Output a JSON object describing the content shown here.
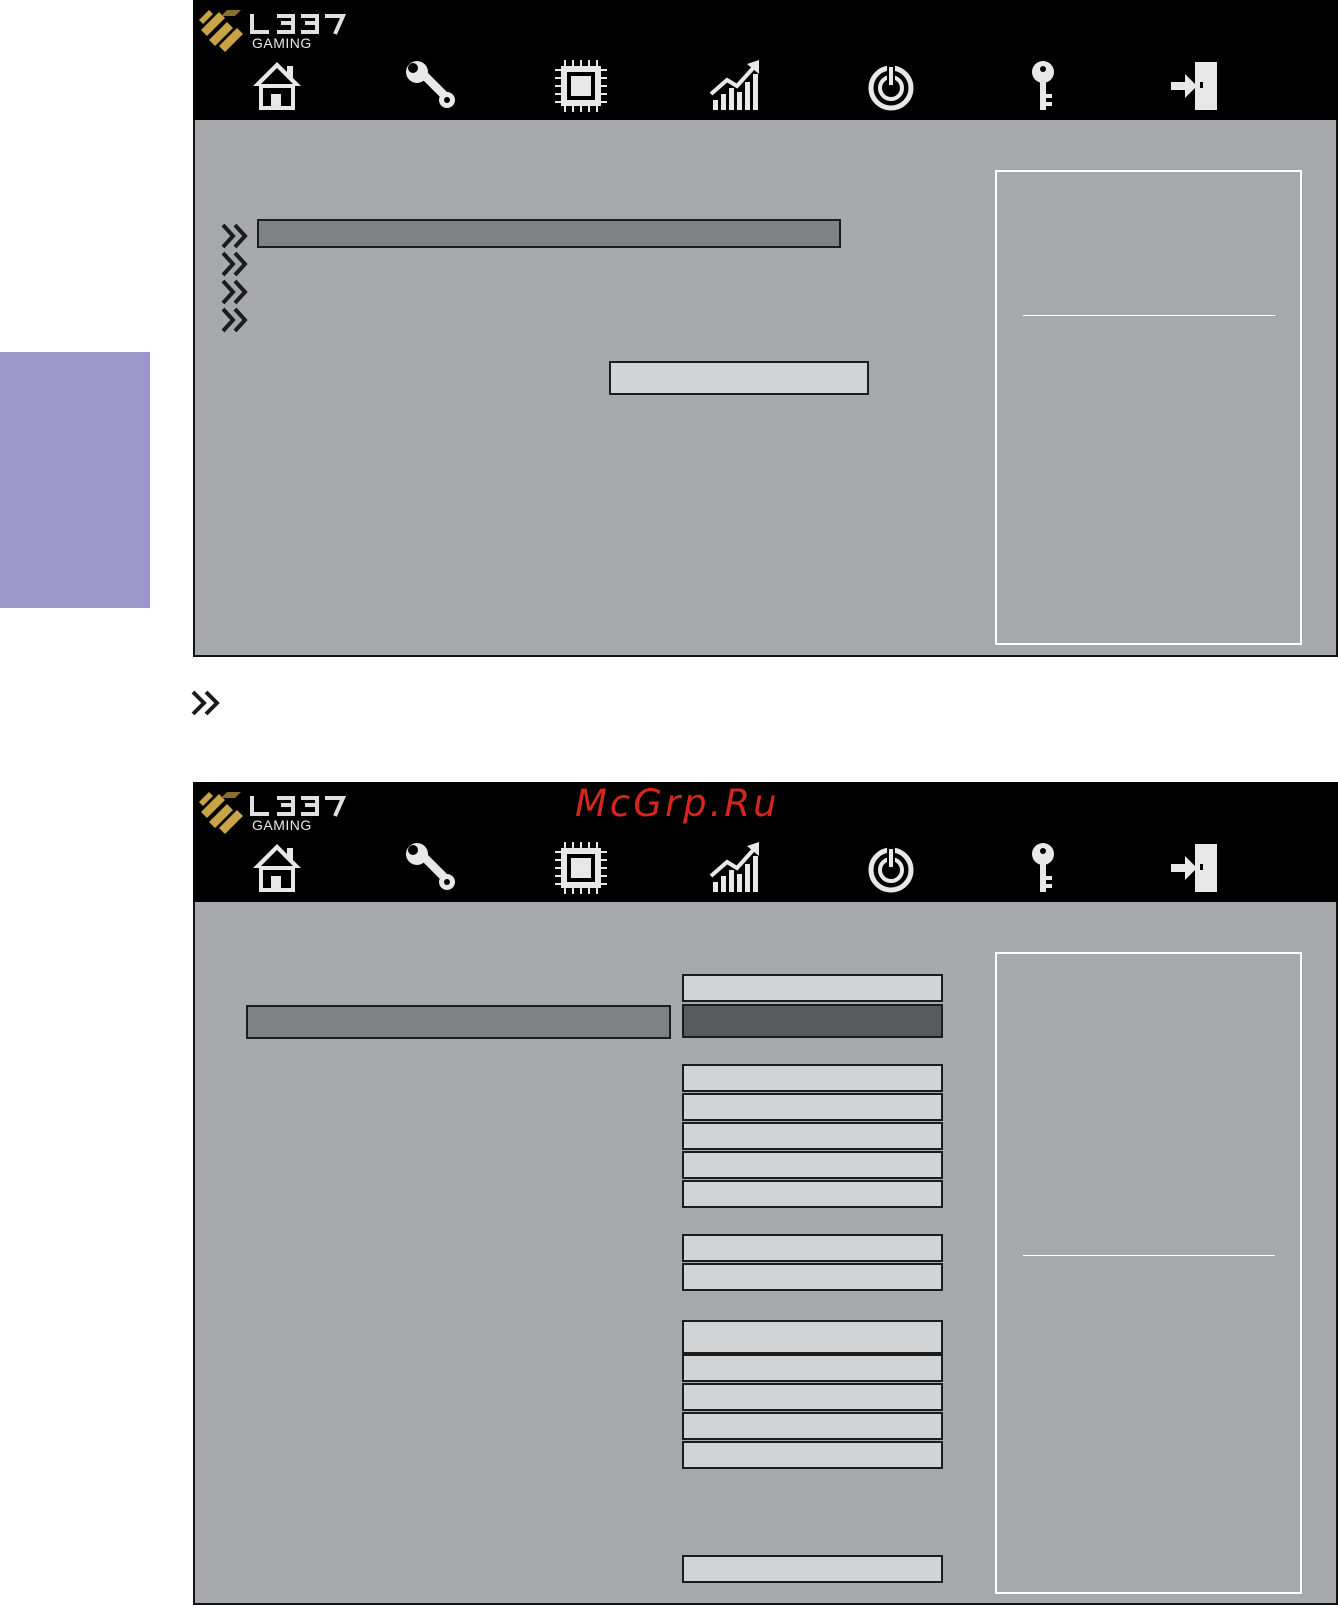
{
  "brand": {
    "logo_text": "L337",
    "logo_subtext": "GAMING"
  },
  "watermark": "McGrp.Ru",
  "nav_icons": [
    "home-icon",
    "wrench-icon",
    "chip-icon",
    "chart-icon",
    "power-icon",
    "key-icon",
    "exit-icon"
  ],
  "colors": {
    "side_tab": "#9e97cb",
    "screen_bg": "#a7a8ac",
    "topbar": "#000000",
    "field_light": "#d2d3d5",
    "field_mid": "#808185",
    "field_dark": "#58595b",
    "watermark": "#d6261c",
    "logo_gold": "#c9a447"
  }
}
